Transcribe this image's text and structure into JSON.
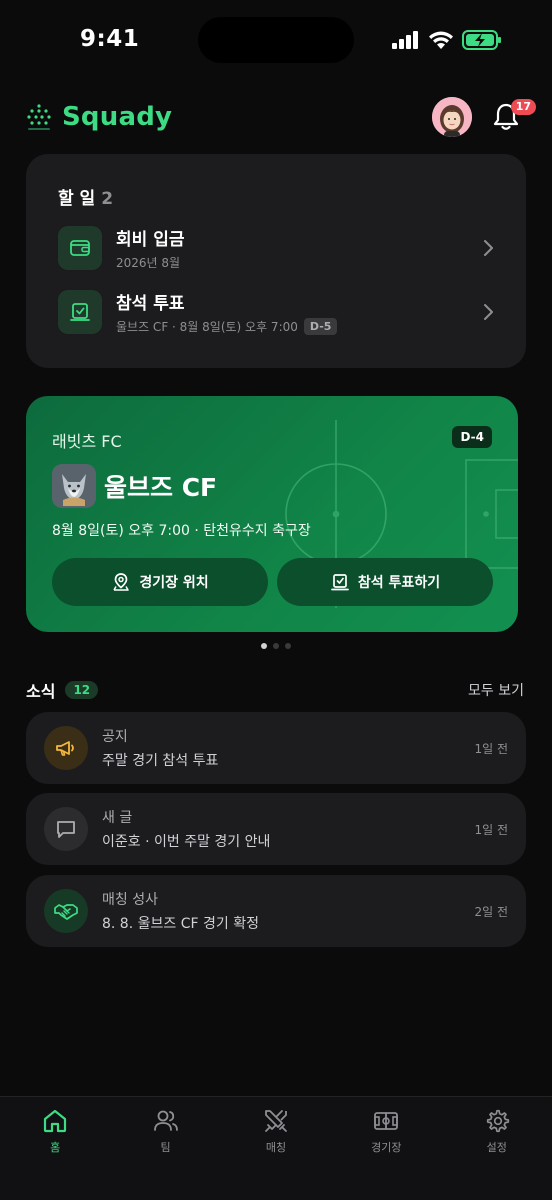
{
  "status_bar": {
    "time": "9:41"
  },
  "header": {
    "brand": "Squady",
    "notification_count": "17"
  },
  "todo": {
    "title": "할 일",
    "count": "2",
    "items": [
      {
        "label": "회비 입금",
        "sub": "2026년 8월",
        "icon": "wallet-icon"
      },
      {
        "label": "참석 투표",
        "sub": "울브즈 CF · 8월 8일(토) 오후 7:00",
        "chip": "D-5",
        "icon": "vote-icon"
      }
    ]
  },
  "match": {
    "team": "래빗츠 FC",
    "dday": "D-4",
    "opponent": "울브즈 CF",
    "info": "8월 8일(토) 오후 7:00 · 탄천유수지 축구장",
    "location_button": "경기장 위치",
    "vote_button": "참석 투표하기",
    "page_count": 3,
    "active_page": 1
  },
  "news": {
    "title": "소식",
    "count": "12",
    "see_all": "모두 보기",
    "items": [
      {
        "category": "공지",
        "text": "주말 경기 참석 투표",
        "time": "1일 전",
        "icon": "megaphone-icon"
      },
      {
        "category": "새 글",
        "text": "이준호 · 이번 주말 경기 안내",
        "time": "1일 전",
        "icon": "chat-icon"
      },
      {
        "category": "매칭 성사",
        "text": "8. 8. 울브즈 CF 경기 확정",
        "time": "2일 전",
        "icon": "handshake-icon"
      }
    ]
  },
  "tabs": [
    {
      "label": "홈",
      "icon": "home-icon",
      "active": true
    },
    {
      "label": "팀",
      "icon": "team-icon",
      "active": false
    },
    {
      "label": "매칭",
      "icon": "swords-icon",
      "active": false
    },
    {
      "label": "경기장",
      "icon": "field-icon",
      "active": false
    },
    {
      "label": "설정",
      "icon": "gear-icon",
      "active": false
    }
  ],
  "colors": {
    "accent": "#3ddc84",
    "card": "#1c1c1e",
    "background": "#0b0b0c",
    "match_card": "#118548",
    "badge": "#ef4b55"
  }
}
